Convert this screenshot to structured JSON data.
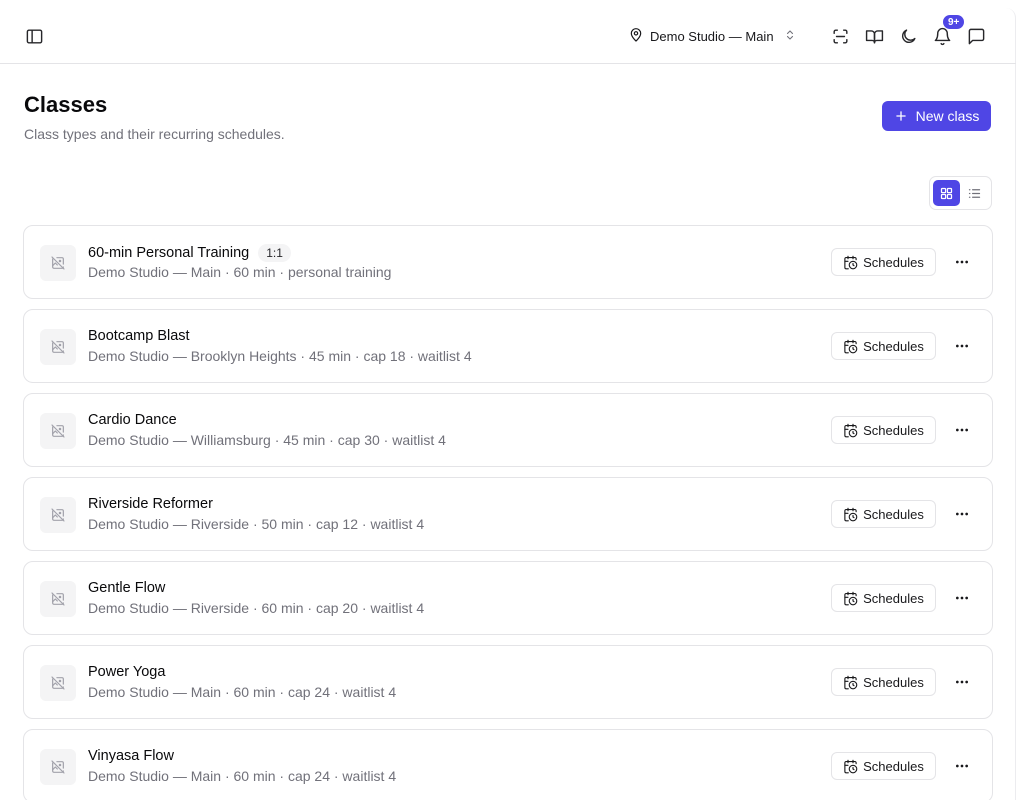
{
  "header": {
    "studio_name": "Demo Studio — Main",
    "notification_count": "9+"
  },
  "page": {
    "title": "Classes",
    "subtitle": "Class types and their recurring schedules.",
    "new_class_label": "New class",
    "view_mode": "grid"
  },
  "classes": [
    {
      "name": "60-min Personal Training",
      "tag": "1:1",
      "meta": "Demo Studio — Main · 60 min · personal training",
      "schedules_label": "Schedules"
    },
    {
      "name": "Bootcamp Blast",
      "tag": "",
      "meta": "Demo Studio — Brooklyn Heights · 45 min · cap 18 · waitlist 4",
      "schedules_label": "Schedules"
    },
    {
      "name": "Cardio Dance",
      "tag": "",
      "meta": "Demo Studio — Williamsburg · 45 min · cap 30 · waitlist 4",
      "schedules_label": "Schedules"
    },
    {
      "name": "Riverside Reformer",
      "tag": "",
      "meta": "Demo Studio — Riverside · 50 min · cap 12 · waitlist 4",
      "schedules_label": "Schedules"
    },
    {
      "name": "Gentle Flow",
      "tag": "",
      "meta": "Demo Studio — Riverside · 60 min · cap 20 · waitlist 4",
      "schedules_label": "Schedules"
    },
    {
      "name": "Power Yoga",
      "tag": "",
      "meta": "Demo Studio — Main · 60 min · cap 24 · waitlist 4",
      "schedules_label": "Schedules"
    },
    {
      "name": "Vinyasa Flow",
      "tag": "",
      "meta": "Demo Studio — Main · 60 min · cap 24 · waitlist 4",
      "schedules_label": "Schedules"
    }
  ],
  "colors": {
    "accent": "#4f46e5",
    "border": "#e4e4e7",
    "muted_text": "#71717a"
  }
}
